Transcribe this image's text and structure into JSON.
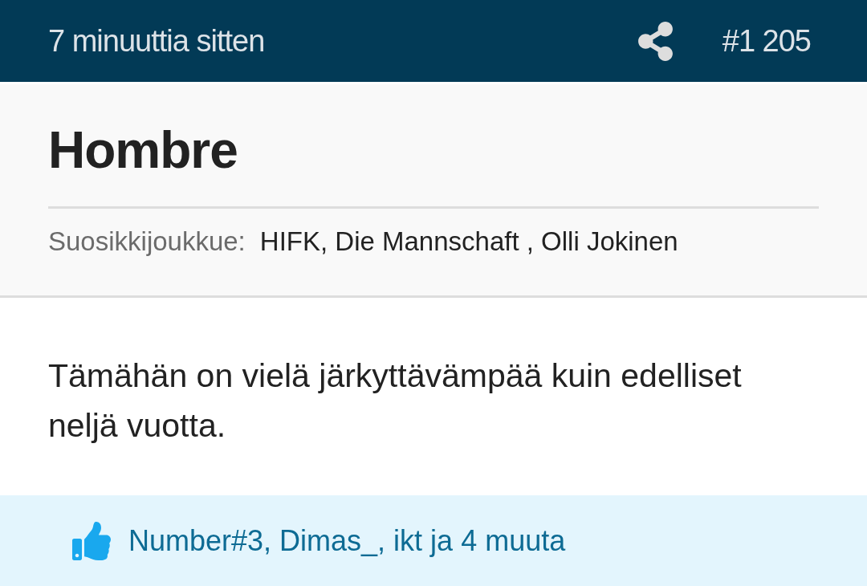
{
  "post_header": {
    "time": "7 minuuttia sitten",
    "post_number": "#1 205"
  },
  "author": {
    "name": "Hombre",
    "favorite_teams": {
      "label": "Suosikkijoukkue:",
      "value": "HIFK, Die Mannschaft , Olli Jokinen"
    }
  },
  "message": "Tämähän on vielä järkyttävämpää kuin edelliset neljä vuotta.",
  "likes": {
    "text": "Number#3, Dimas_, ikt ja 4 muuta"
  }
}
